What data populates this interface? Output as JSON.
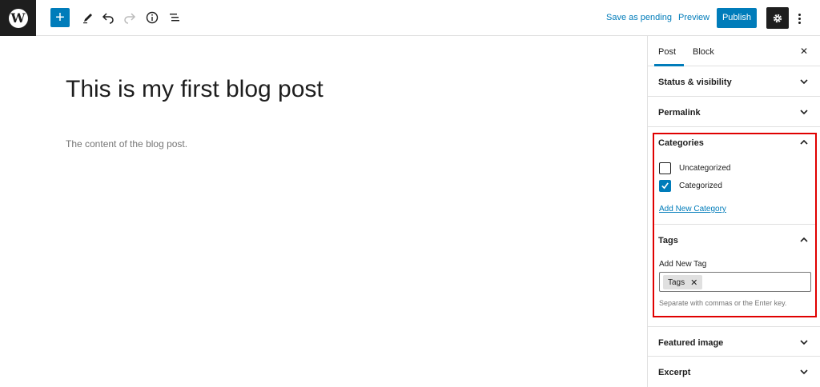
{
  "toolbar": {
    "logo_glyph": "W",
    "add_glyph": "+",
    "save_pending_label": "Save as pending",
    "preview_label": "Preview",
    "publish_label": "Publish"
  },
  "editor": {
    "title": "This is my first blog post",
    "content": "The content of the blog post."
  },
  "sidebar": {
    "tabs": [
      {
        "label": "Post",
        "active": true
      },
      {
        "label": "Block",
        "active": false
      }
    ],
    "close_glyph": "✕",
    "panels": {
      "status_visibility": "Status & visibility",
      "permalink": "Permalink",
      "categories": {
        "title": "Categories",
        "options": [
          {
            "label": "Uncategorized",
            "checked": false
          },
          {
            "label": "Categorized",
            "checked": true
          }
        ],
        "add_new_link": "Add New Category"
      },
      "tags": {
        "title": "Tags",
        "add_new_label": "Add New Tag",
        "chips": [
          {
            "label": "Tags",
            "remove_glyph": "✕"
          }
        ],
        "help_text": "Separate with commas or the Enter key."
      },
      "featured_image": "Featured image",
      "excerpt": "Excerpt"
    }
  },
  "colors": {
    "accent": "#007cba",
    "dark": "#1e1e1e",
    "highlight": "#e00000"
  }
}
